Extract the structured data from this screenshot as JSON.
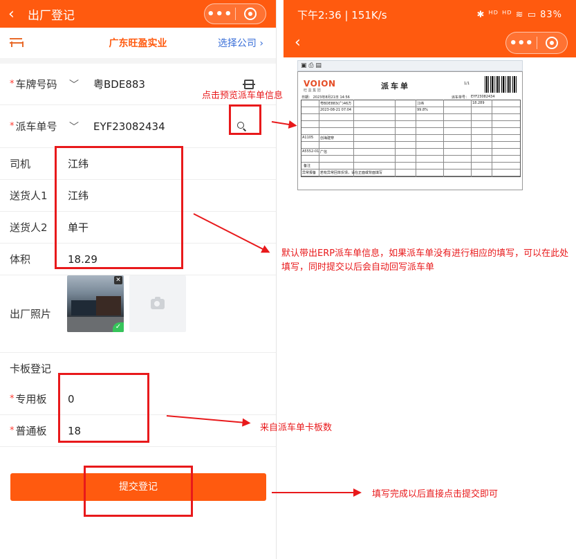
{
  "left": {
    "header": {
      "back_icon": "chevron-left-icon",
      "title": "出厂登记",
      "capsule_dots": "•••"
    },
    "company": {
      "name": "广东旺盈实业",
      "select_label": "选择公司 ›"
    },
    "fields": {
      "plate": {
        "label": "车牌号码",
        "value": "粤BDE883"
      },
      "dispatch": {
        "label": "派车单号",
        "value": "EYF23082434"
      },
      "driver": {
        "label": "司机",
        "value": "江纬"
      },
      "sender1": {
        "label": "送货人1",
        "value": "江纬"
      },
      "sender2": {
        "label": "送货人2",
        "value": "单干"
      },
      "volume": {
        "label": "体积",
        "value": "18.29"
      },
      "photo": {
        "label": "出厂照片"
      },
      "pallet_section": {
        "label": "卡板登记"
      },
      "special_board": {
        "label": "专用板",
        "value": "0"
      },
      "normal_board": {
        "label": "普通板",
        "value": "18"
      }
    },
    "required_mark": "*",
    "submit_label": "提交登记"
  },
  "notes": {
    "preview": "点击预览派车单信息",
    "erp": "默认带出ERP派车单信息，如果派车单没有进行相应的填写，可以在此处填写，同时提交以后会自动回写派车单",
    "pallet": "来自派车单卡板数",
    "submit": "填写完成以后直接点击提交即可"
  },
  "right": {
    "status": {
      "time": "下午2:36 | 151K/s",
      "icons": "✱ ᴴᴰ ᴴᴰ ≋ ▭ 83%"
    },
    "doc": {
      "toolbar": "▣ ⎙ ▤",
      "logo": "VOION",
      "logo_sub": "旺 盈 集 团",
      "title": "派车单",
      "page": "1/1",
      "dispatch_no_label": "派车单号：",
      "dispatch_no": "EYF23082434",
      "date": "日期： 2023年8月21日 14:56",
      "plate": "粤BDE883(广)46方",
      "driver": "江纬",
      "volume": "18.289",
      "out_time": "2023-08-21 07:04",
      "rate": "99.8%",
      "customer1": "A1105",
      "customer1_name": "创海建穿",
      "customer2": "A5552-01",
      "customer2_name": "广信",
      "note_label": "备注",
      "exception_label": "异常报备",
      "exception_text": "若有异常回单反馈，请在正面或背面填写"
    }
  }
}
